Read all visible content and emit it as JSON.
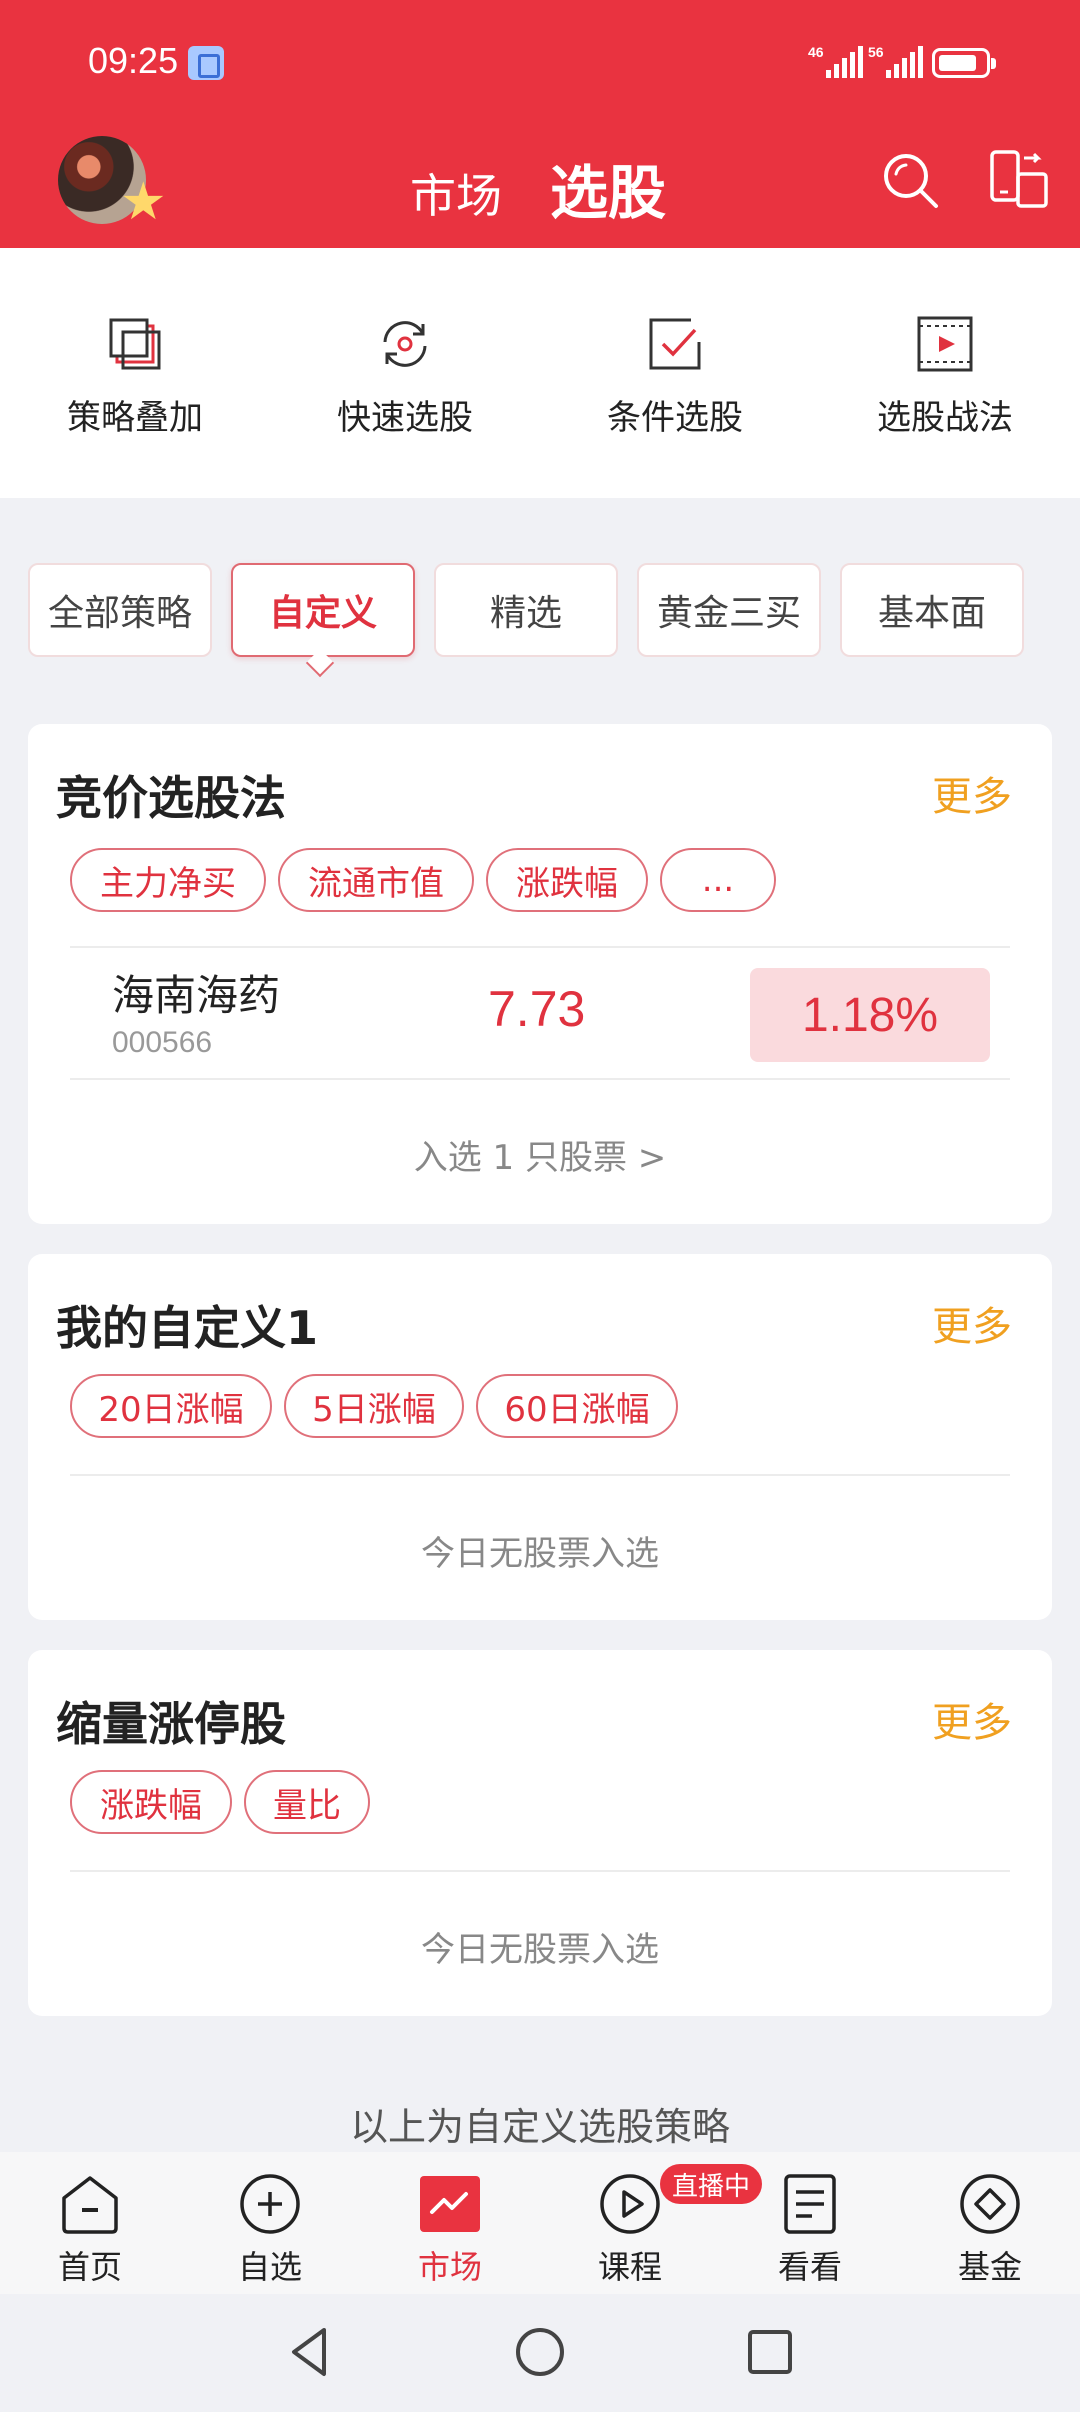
{
  "status_bar": {
    "time": "09:25",
    "network_1": "46",
    "network_2": "56",
    "battery_level": 0.8
  },
  "header": {
    "tab_market": "市场",
    "tab_stock_select": "选股",
    "icons": [
      "search-icon",
      "switch-device-icon"
    ]
  },
  "tools": [
    {
      "label": "策略叠加",
      "icon": "overlay-icon"
    },
    {
      "label": "快速选股",
      "icon": "refresh-icon"
    },
    {
      "label": "条件选股",
      "icon": "checkbox-icon"
    },
    {
      "label": "选股战法",
      "icon": "video-icon"
    }
  ],
  "strategy_tabs": [
    {
      "label": "全部策略"
    },
    {
      "label": "自定义",
      "active": true
    },
    {
      "label": "精选"
    },
    {
      "label": "黄金三买"
    },
    {
      "label": "基本面"
    }
  ],
  "cards": [
    {
      "title": "竞价选股法",
      "more": "更多",
      "chips": [
        "主力净买",
        "流通市值",
        "涨跌幅",
        "..."
      ],
      "stock": {
        "name": "海南海药",
        "code": "000566",
        "price": "7.73",
        "change": "1.18%"
      },
      "footer": "入选 1 只股票 >"
    },
    {
      "title": "我的自定义1",
      "more": "更多",
      "chips": [
        "20日涨幅",
        "5日涨幅",
        "60日涨幅"
      ],
      "footer": "今日无股票入选"
    },
    {
      "title": "缩量涨停股",
      "more": "更多",
      "chips": [
        "涨跌幅",
        "量比"
      ],
      "footer": "今日无股票入选"
    }
  ],
  "list_footer": "以上为自定义选股策略",
  "bottom_nav": [
    {
      "label": "首页",
      "icon": "home-icon"
    },
    {
      "label": "自选",
      "icon": "plus-circle-icon"
    },
    {
      "label": "市场",
      "icon": "market-chart-icon",
      "active": true
    },
    {
      "label": "课程",
      "icon": "play-circle-icon"
    },
    {
      "label": "看看",
      "icon": "document-icon"
    },
    {
      "label": "基金",
      "icon": "diamond-icon"
    }
  ],
  "live_badge": "直播中",
  "colors": {
    "brand_red": "#e93340",
    "more_orange": "#f0a020",
    "change_bg": "#fadadd"
  }
}
